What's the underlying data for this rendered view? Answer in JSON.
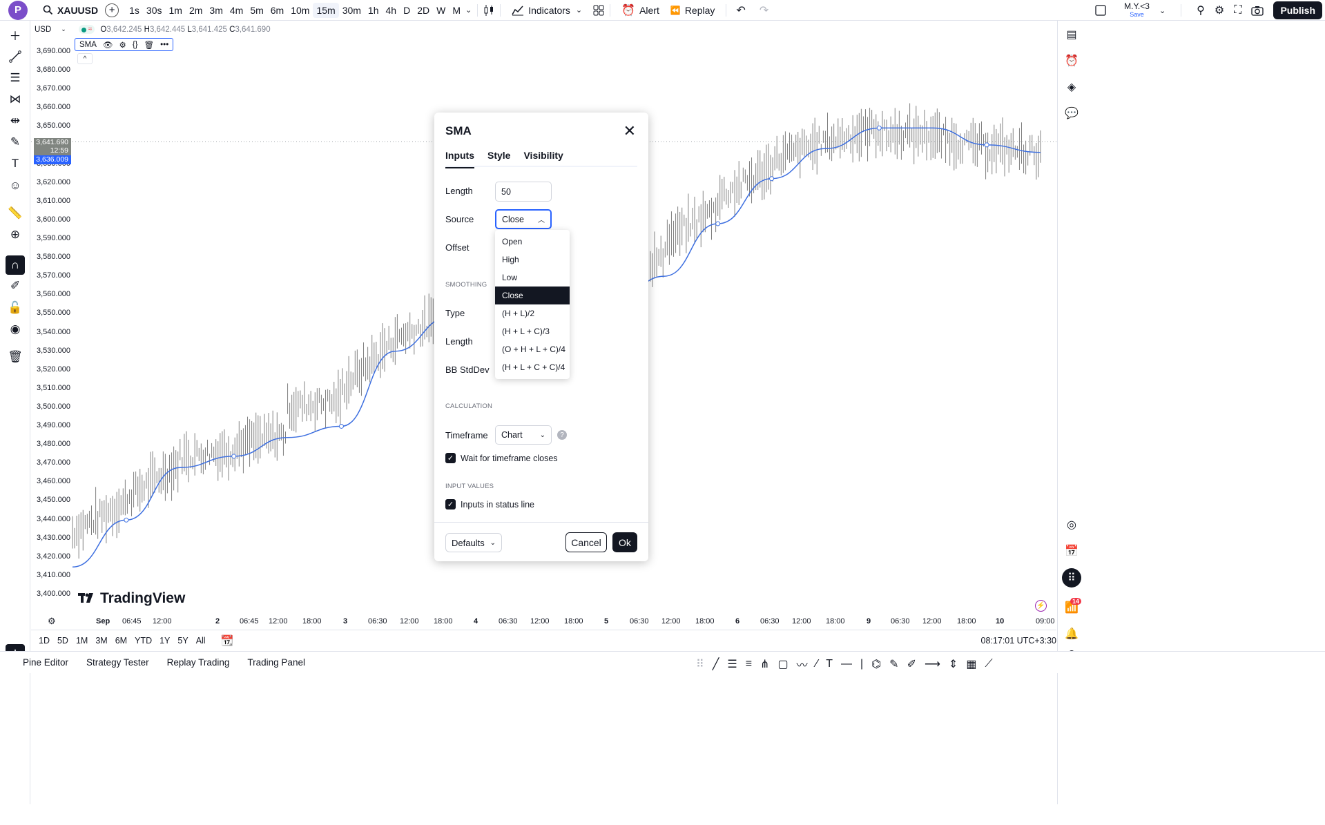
{
  "topbar": {
    "logo_letter": "P",
    "symbol": "XAUUSD",
    "intervals": [
      "1s",
      "30s",
      "1m",
      "2m",
      "3m",
      "4m",
      "5m",
      "6m",
      "10m",
      "15m",
      "30m",
      "1h",
      "4h",
      "D",
      "2D",
      "W",
      "M"
    ],
    "active_interval": "15m",
    "indicators_label": "Indicators",
    "alert_label": "Alert",
    "replay_label": "Replay",
    "user_name": "M.Y.<3",
    "user_save": "Save",
    "publish_label": "Publish"
  },
  "legend": {
    "currency": "USD",
    "open_label": "O",
    "open": "3,642.245",
    "high_label": "H",
    "high": "3,642.445",
    "low_label": "L",
    "low": "3,641.425",
    "close_label": "C",
    "close": "3,641.690",
    "sma_label": "SMA"
  },
  "price_axis": [
    "3,690.000",
    "3,680.000",
    "3,670.000",
    "3,660.000",
    "3,650.000",
    "3,640.000",
    "3,630.000",
    "3,620.000",
    "3,610.000",
    "3,600.000",
    "3,590.000",
    "3,580.000",
    "3,570.000",
    "3,560.000",
    "3,550.000",
    "3,540.000",
    "3,530.000",
    "3,520.000",
    "3,510.000",
    "3,500.000",
    "3,490.000",
    "3,480.000",
    "3,470.000",
    "3,460.000",
    "3,450.000",
    "3,440.000",
    "3,430.000",
    "3,420.000",
    "3,410.000",
    "3,400.000"
  ],
  "price_badges": {
    "last": "3,641.690",
    "countdown": "12:59",
    "sma": "3,636.009"
  },
  "time_axis": [
    "Sep",
    "06:45",
    "12:00",
    "2",
    "06:45",
    "12:00",
    "18:00",
    "3",
    "06:30",
    "12:00",
    "18:00",
    "4",
    "06:30",
    "12:00",
    "18:00",
    "5",
    "06:30",
    "12:00",
    "18:00",
    "6",
    "06:30",
    "12:00",
    "18:00",
    "9",
    "06:30",
    "12:00",
    "18:00",
    "10",
    "09:00"
  ],
  "ranges": [
    "1D",
    "5D",
    "1M",
    "3M",
    "6M",
    "YTD",
    "1Y",
    "5Y",
    "All"
  ],
  "clock": "08:17:01 UTC+3:30",
  "watermark": "TradingView",
  "footer_tabs": [
    "Pine Editor",
    "Strategy Tester",
    "Replay Trading",
    "Trading Panel"
  ],
  "notification_count": "14",
  "dialog": {
    "title": "SMA",
    "tabs": [
      "Inputs",
      "Style",
      "Visibility"
    ],
    "length_label": "Length",
    "length_value": "50",
    "source_label": "Source",
    "source_value": "Close",
    "offset_label": "Offset",
    "smoothing_header": "SMOOTHING",
    "type_label": "Type",
    "smooth_length_label": "Length",
    "bb_label": "BB StdDev",
    "calc_header": "CALCULATION",
    "timeframe_label": "Timeframe",
    "timeframe_value": "Chart",
    "wait_label": "Wait for timeframe closes",
    "input_values_header": "INPUT VALUES",
    "status_line_label": "Inputs in status line",
    "defaults_label": "Defaults",
    "cancel_label": "Cancel",
    "ok_label": "Ok"
  },
  "source_menu": {
    "options": [
      "Open",
      "High",
      "Low",
      "Close",
      "(H + L)/2",
      "(H + L + C)/3",
      "(O + H + L + C)/4",
      "(H + L + C + C)/4"
    ],
    "selected": "Close"
  },
  "colors": {
    "sma_line": "#3d6fe0",
    "accent": "#2962ff",
    "candle": "#808080",
    "badge_price": "#808580",
    "badge_sma": "#2962ff"
  },
  "chart_data": {
    "type": "line",
    "series": [
      {
        "name": "SMA",
        "values": [
          3415,
          3440,
          3468,
          3474,
          3484,
          3490,
          3530,
          3548,
          3550,
          3545,
          3553,
          3570,
          3598,
          3622,
          3638,
          3649,
          3649,
          3640,
          3636
        ]
      }
    ],
    "x": [
      "Sep",
      "06:45",
      "12:00",
      "2",
      "12:00",
      "18:00",
      "3",
      "12:00",
      "18:00",
      "4",
      "5",
      "12:00",
      "6",
      "12:00",
      "18:00",
      "9",
      "12:00",
      "18:00",
      "10"
    ],
    "ylim": [
      3400,
      3690
    ]
  }
}
